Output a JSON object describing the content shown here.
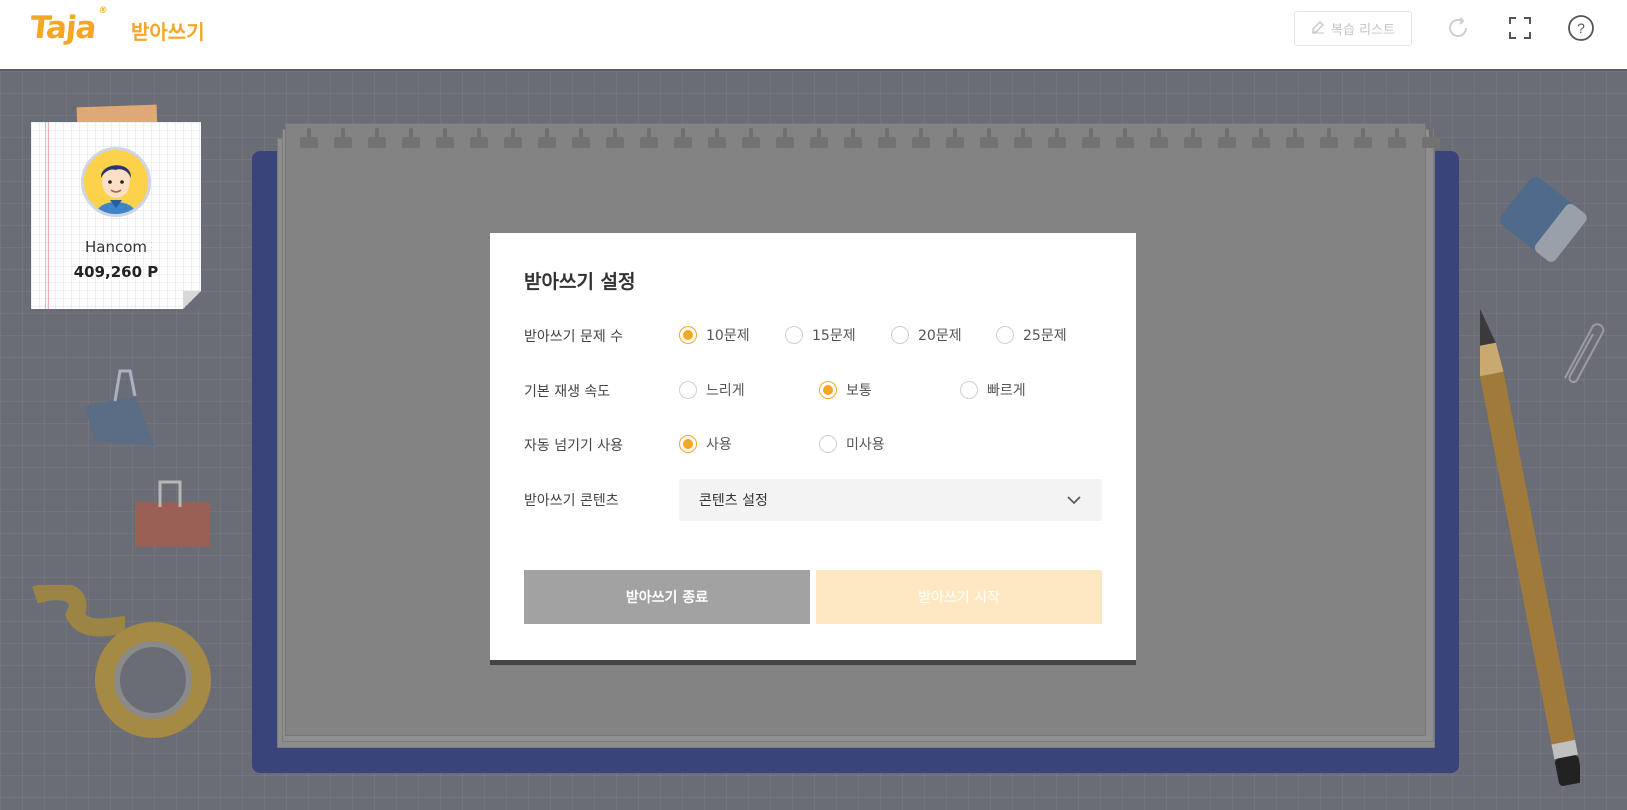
{
  "header": {
    "logo_text": "Taja",
    "logo_mark": "®",
    "app_title": "받아쓰기",
    "review_list_label": "복습 리스트",
    "icons": [
      "edit-icon",
      "refresh-icon",
      "fullscreen-icon",
      "help-icon"
    ]
  },
  "profile": {
    "name": "Hancom",
    "points": "409,260 P"
  },
  "modal": {
    "title": "받아쓰기 설정",
    "question_count": {
      "label": "받아쓰기 문제 수",
      "options": [
        "10문제",
        "15문제",
        "20문제",
        "25문제"
      ],
      "selected": "10문제"
    },
    "playback_speed": {
      "label": "기본 재생 속도",
      "options": [
        "느리게",
        "보통",
        "빠르게"
      ],
      "selected": "보통"
    },
    "auto_advance": {
      "label": "자동 넘기기 사용",
      "options": [
        "사용",
        "미사용"
      ],
      "selected": "사용"
    },
    "content": {
      "label": "받아쓰기 콘텐츠",
      "select_value": "콘텐츠 설정"
    },
    "end_button": "받아쓰기 종료",
    "start_button": "받아쓰기 시작"
  },
  "colors": {
    "accent": "#f5a623",
    "board": "#38447a",
    "end_button": "#a2a2a2",
    "start_button_disabled": "#fde8c1"
  }
}
